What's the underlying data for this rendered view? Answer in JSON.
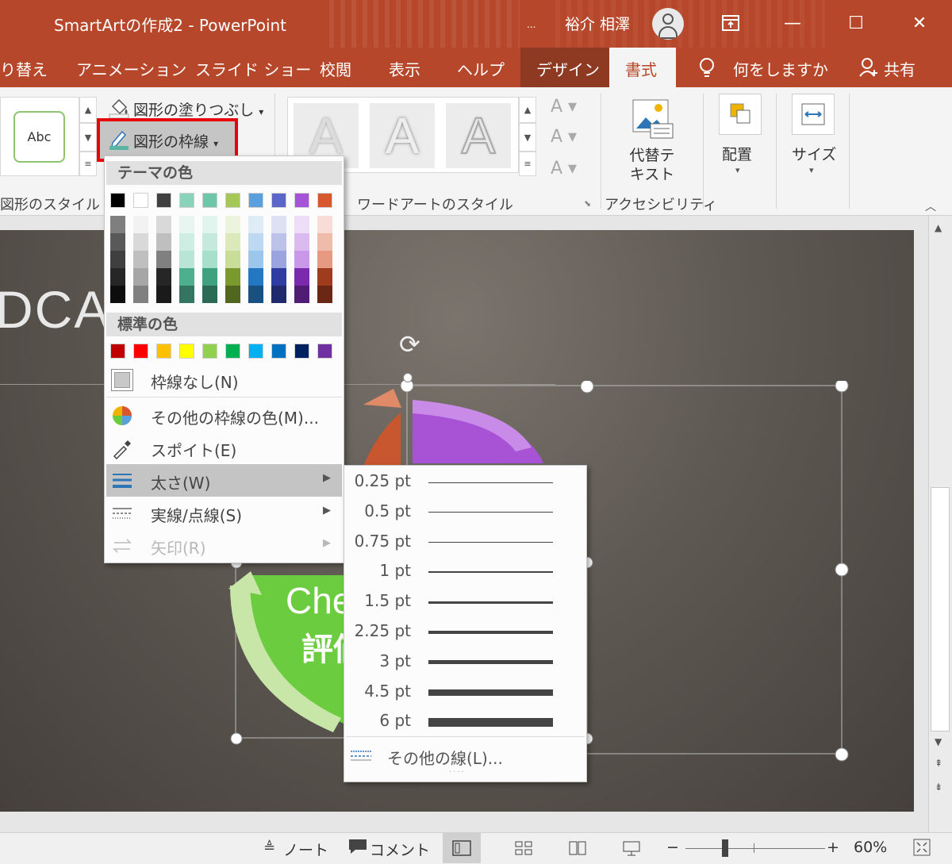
{
  "titlebar": {
    "title": "SmartArtの作成2  -  PowerPoint",
    "dots": "...",
    "user": "裕介 相澤",
    "ribbon_display_icon": "ribbon-display-icon",
    "minimize": "—",
    "maximize": "☐",
    "close": "✕"
  },
  "tabs": [
    {
      "label": "り替え"
    },
    {
      "label": "アニメーション"
    },
    {
      "label": "スライド ショー"
    },
    {
      "label": "校閲"
    },
    {
      "label": "表示"
    },
    {
      "label": "ヘルプ"
    },
    {
      "label": "デザイン"
    },
    {
      "label": "書式"
    },
    {
      "label": "何をしますか"
    },
    {
      "label": "共有"
    }
  ],
  "ribbon": {
    "abc_label": "Abc",
    "shape_fill": "図形の塗りつぶし",
    "shape_outline": "図形の枠線",
    "shape_styles_group": "図形のスタイル",
    "wordart_letter": "A",
    "wordart_group": "ワードアートのスタイル",
    "alt_text": "代替テキスト",
    "alt_text_line1": "代替テ",
    "alt_text_line2": "キスト",
    "accessibility_group": "アクセシビリティ",
    "arrange": "配置",
    "size": "サイズ"
  },
  "slide": {
    "title_fragment": "DCA",
    "smartart_text1": "Che",
    "smartart_text2": "評価"
  },
  "outline_menu": {
    "theme_colors_header": "テーマの色",
    "standard_colors_header": "標準の色",
    "theme_colors": [
      "#000000",
      "#ffffff",
      "#404040",
      "#88d3b9",
      "#6dc8a9",
      "#a5c755",
      "#5aa0de",
      "#5a67c9",
      "#a553d8",
      "#d7572f"
    ],
    "theme_shades": [
      [
        "#7f7f7f",
        "#595959",
        "#3f3f3f",
        "#262626",
        "#0d0d0d"
      ],
      [
        "#f2f2f2",
        "#d9d9d9",
        "#bfbfbf",
        "#a6a6a6",
        "#808080"
      ],
      [
        "#d9d9d9",
        "#bfbfbf",
        "#808080",
        "#262626",
        "#1a1a1a"
      ],
      [
        "#e7f6f1",
        "#cfeee3",
        "#b8e5d5",
        "#4daf8d",
        "#337561"
      ],
      [
        "#e2f4ee",
        "#c5e9dd",
        "#a7dfcb",
        "#40a17f",
        "#2b6b55"
      ],
      [
        "#edf4dd",
        "#dbe9bb",
        "#c9dd99",
        "#7a9a2e",
        "#51661f"
      ],
      [
        "#deecf8",
        "#bdd9f2",
        "#9cc6eb",
        "#2478c2",
        "#185081"
      ],
      [
        "#dee1f4",
        "#bdc2e9",
        "#9ca4df",
        "#2f3da2",
        "#20296c"
      ],
      [
        "#edddf7",
        "#dbbbef",
        "#c999e7",
        "#7a2aad",
        "#511c73"
      ],
      [
        "#f7ddd5",
        "#efbcab",
        "#e79a82",
        "#9f3c1e",
        "#6a2814"
      ]
    ],
    "standard_colors": [
      "#c00000",
      "#ff0000",
      "#ffc000",
      "#ffff00",
      "#92d050",
      "#00b050",
      "#00b0f0",
      "#0070c0",
      "#002060",
      "#7030a0"
    ],
    "no_outline": "枠線なし(N)",
    "more_colors": "その他の枠線の色(M)...",
    "eyedropper": "スポイト(E)",
    "weight": "太さ(W)",
    "dashes": "実線/点線(S)",
    "arrows": "矢印(R)"
  },
  "weight_menu": {
    "items": [
      {
        "label": "0.25 pt",
        "pt": 0.25
      },
      {
        "label": "0.5 pt",
        "pt": 0.5
      },
      {
        "label": "0.75 pt",
        "pt": 0.75
      },
      {
        "label": "1 pt",
        "pt": 1
      },
      {
        "label": "1.5 pt",
        "pt": 1.5
      },
      {
        "label": "2.25 pt",
        "pt": 2.25
      },
      {
        "label": "3 pt",
        "pt": 3
      },
      {
        "label": "4.5 pt",
        "pt": 4.5
      },
      {
        "label": "6 pt",
        "pt": 6
      }
    ],
    "more_lines": "その他の線(L)..."
  },
  "statusbar": {
    "notes": "ノート",
    "comments": "コメント",
    "zoom_minus": "−",
    "zoom_plus": "+",
    "zoom_level": "60%"
  }
}
